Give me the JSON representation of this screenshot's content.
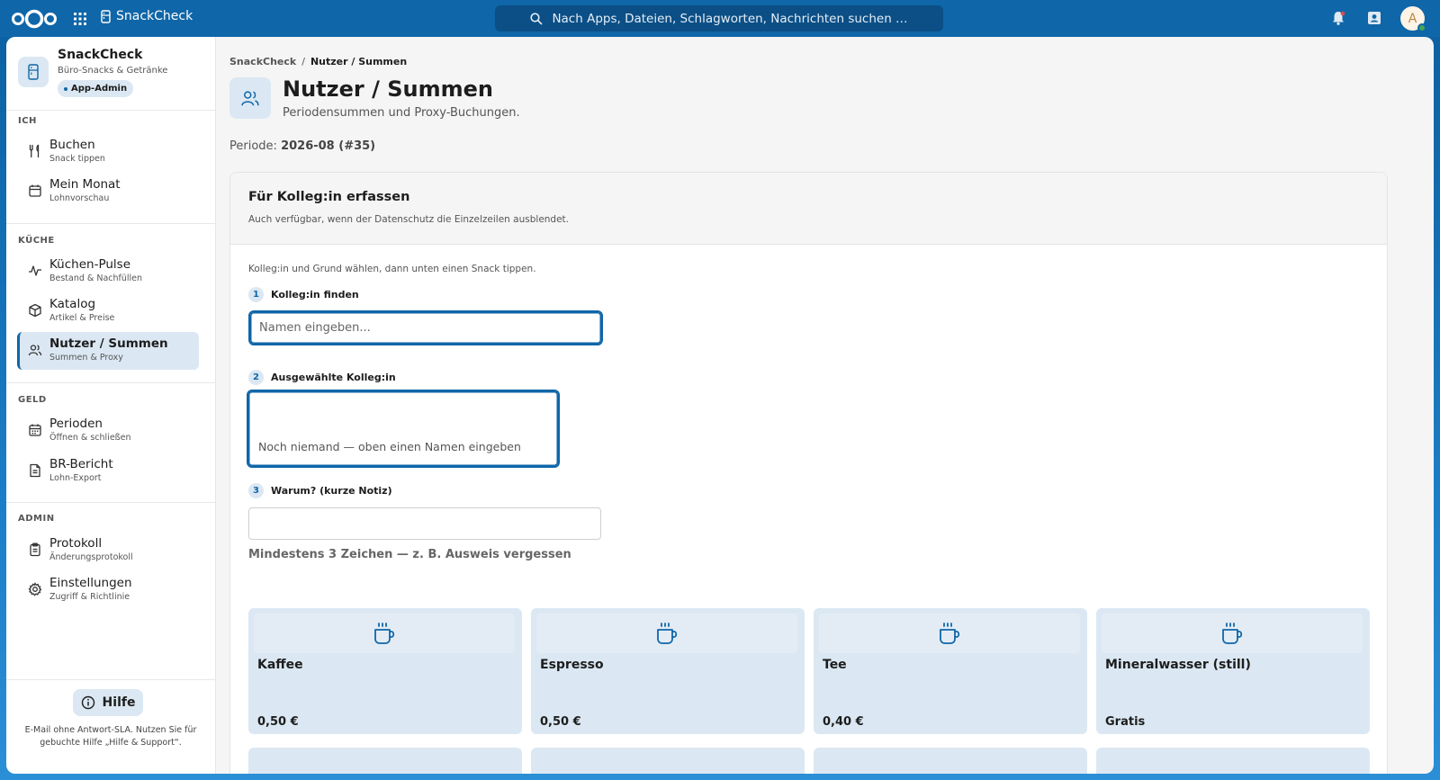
{
  "topbar": {
    "app_name": "SnackCheck",
    "search_placeholder": "Nach Apps, Dateien, Schlagworten, Nachrichten suchen …",
    "avatar_initial": "A",
    "icons": [
      "nextcloud-logo",
      "apps-grid-icon",
      "search-icon",
      "bell-icon",
      "contacts-icon"
    ]
  },
  "sidebar": {
    "brand_title": "SnackCheck",
    "brand_subtitle": "Büro-Snacks & Getränke",
    "role_badge": "App-Admin",
    "sections": [
      {
        "label": "ICH",
        "items": [
          {
            "label": "Buchen",
            "sub": "Snack tippen",
            "icon": "fork-knife-icon"
          },
          {
            "label": "Mein Monat",
            "sub": "Lohnvorschau",
            "icon": "calendar-icon"
          }
        ]
      },
      {
        "label": "KÜCHE",
        "items": [
          {
            "label": "Küchen-Pulse",
            "sub": "Bestand & Nachfüllen",
            "icon": "pulse-icon"
          },
          {
            "label": "Katalog",
            "sub": "Artikel & Preise",
            "icon": "box-icon"
          },
          {
            "label": "Nutzer / Summen",
            "sub": "Summen & Proxy",
            "icon": "users-icon",
            "active": true
          }
        ]
      },
      {
        "label": "GELD",
        "items": [
          {
            "label": "Perioden",
            "sub": "Öffnen & schließen",
            "icon": "calendar-grid-icon"
          },
          {
            "label": "BR-Bericht",
            "sub": "Lohn-Export",
            "icon": "document-icon"
          }
        ]
      },
      {
        "label": "ADMIN",
        "items": [
          {
            "label": "Protokoll",
            "sub": "Änderungsprotokoll",
            "icon": "clipboard-icon"
          },
          {
            "label": "Einstellungen",
            "sub": "Zugriff & Richtlinie",
            "icon": "gear-icon"
          }
        ]
      }
    ],
    "help_label": "Hilfe",
    "help_note": "E-Mail ohne Antwort-SLA. Nutzen Sie für gebuchte Hilfe „Hilfe & Support“."
  },
  "main": {
    "breadcrumb": [
      "SnackCheck",
      "Nutzer / Summen"
    ],
    "title": "Nutzer / Summen",
    "subtitle": "Periodensummen und Proxy-Buchungen.",
    "period_label": "Periode:",
    "period_value": "2026-08 (#35)",
    "proxy_card": {
      "title": "Für Kolleg:in erfassen",
      "subtitle": "Auch verfügbar, wenn der Datenschutz die Einzelzeilen ausblendet.",
      "intro": "Kolleg:in und Grund wählen, dann unten einen Snack tippen.",
      "steps": [
        {
          "num": "1",
          "label": "Kolleg:in finden"
        },
        {
          "num": "2",
          "label": "Ausgewählte Kolleg:in"
        },
        {
          "num": "3",
          "label": "Warum? (kurze Notiz)"
        }
      ],
      "search_placeholder": "Namen eingeben...",
      "selected_empty": "Noch niemand — oben einen Namen eingeben",
      "note_value": "",
      "note_hint": "Mindestens 3 Zeichen — z. B. Ausweis vergessen",
      "products": [
        {
          "name": "Kaffee",
          "price": "0,50 €",
          "icon": "cup-icon"
        },
        {
          "name": "Espresso",
          "price": "0,50 €",
          "icon": "cup-icon"
        },
        {
          "name": "Tee",
          "price": "0,40 €",
          "icon": "cup-icon"
        },
        {
          "name": "Mineralwasser (still)",
          "price": "Gratis",
          "icon": "cup-icon"
        }
      ]
    }
  },
  "colors": {
    "accent": "#0f66a8",
    "accent_light": "#dbe8f3",
    "background": "#f5f5f5"
  }
}
